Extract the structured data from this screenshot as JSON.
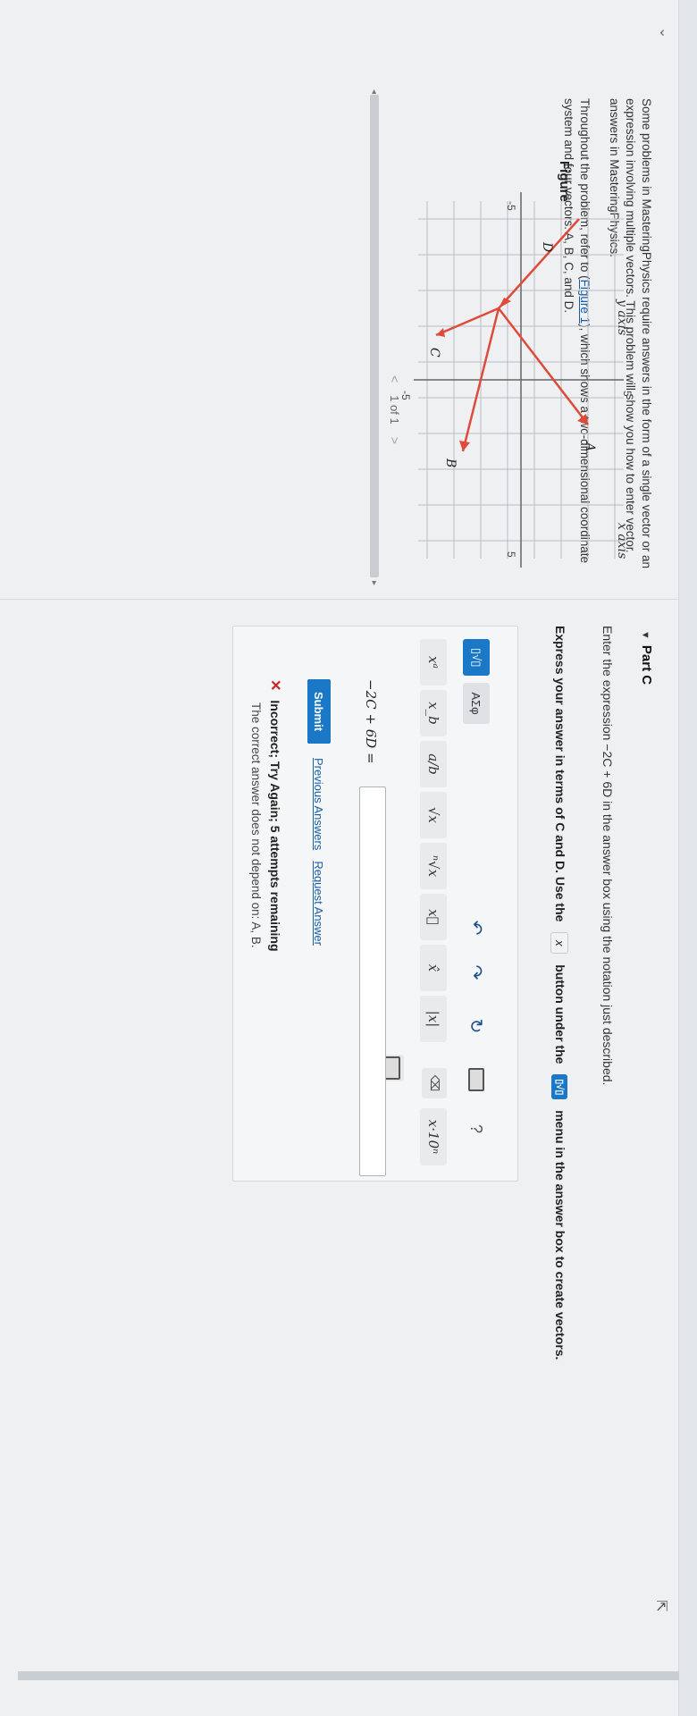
{
  "intro": {
    "p1": "Some problems in MasteringPhysics require answers in the form of a single vector or an expression involving multiple vectors. This problem will show you how to enter vector answers in MasteringPhysics.",
    "p2_pre": "Throughout the problem, refer to (",
    "p2_link": "Figure 1",
    "p2_post": "), which shows a two-dimensional coordinate system and four vectors: A, B, C, and D."
  },
  "figure": {
    "title": "Figure",
    "y_axis_label": "y axis",
    "x_axis_label": "x axis",
    "tick_labels": [
      "5",
      "-5",
      "5",
      "-5"
    ],
    "vector_labels": [
      "A",
      "B",
      "C",
      "D"
    ],
    "pager_text": "1 of 1",
    "prev_symbol": "<",
    "next_symbol": ">",
    "colors": {
      "grid": "#b9bdc2",
      "vector": "#e04a3a"
    }
  },
  "part_c": {
    "title": "Part C",
    "enter_text": "Enter the expression −2C + 6D in the answer box using the notation just described.",
    "express_pre": "Express your answer in terms of C and D. Use the",
    "express_mid": "button under the",
    "express_post": "menu in the answer box to create vectors.",
    "inline_vector_glyph": "x",
    "inline_template_glyph": "▯√▯"
  },
  "toolbar": {
    "template_btn": "▯√▯",
    "greek_btn": "ΑΣφ",
    "row": [
      "xᵃ",
      "x_b",
      "a/b",
      "√x",
      "ⁿ√x",
      "x⃗",
      "x̂",
      "|x|",
      "x·10ⁿ"
    ],
    "undo_glyph": "↶",
    "redo_glyph": "↷",
    "reset_glyph": "↻",
    "help_glyph": "?",
    "delete_glyph": "⌫"
  },
  "answer": {
    "label": "−2C + 6D =",
    "value": ""
  },
  "actions": {
    "submit": "Submit",
    "previous_answers": "Previous Answers",
    "request_answer": "Request Answer"
  },
  "feedback": {
    "symbol": "✕",
    "message": "Incorrect; Try Again; 5 attempts remaining",
    "detail": "The correct answer does not depend on: A, B."
  }
}
